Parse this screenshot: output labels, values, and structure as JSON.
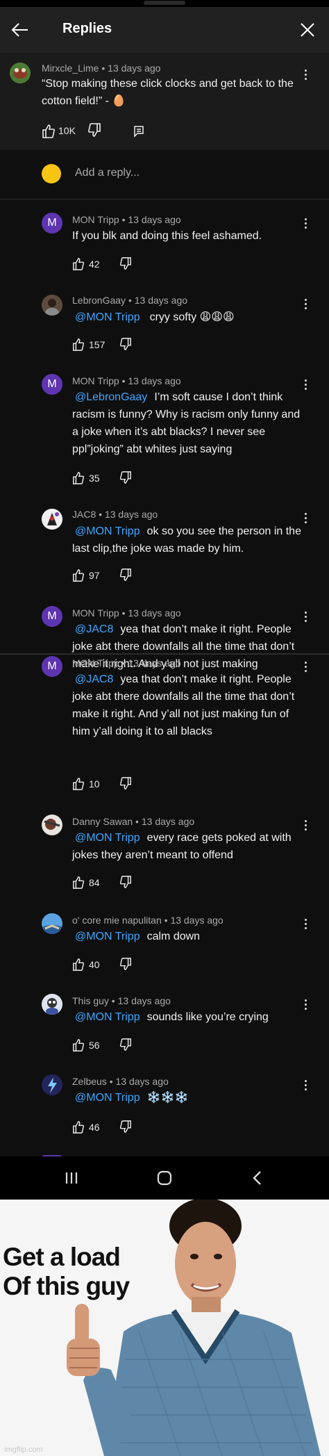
{
  "header": {
    "title": "Replies"
  },
  "parent": {
    "author": "Mirxcle_Lime",
    "age": "13 days ago",
    "text": "“Stop making these click clocks and get back to the cotton field!” - ",
    "likes": "10K"
  },
  "add_reply": {
    "placeholder": "Add a reply..."
  },
  "replies": [
    {
      "author": "MON Tripp",
      "age": "13 days ago",
      "mention": "",
      "text": "If you blk and doing this feel ashamed.",
      "likes": "42",
      "avatar_letter": "M"
    },
    {
      "author": "LebronGaay",
      "age": "13 days ago",
      "mention": "@MON Tripp",
      "text": "cryy softy 😩😩😩",
      "likes": "157",
      "avatar_letter": ""
    },
    {
      "author": "MON Tripp",
      "age": "13 days ago",
      "mention": "@LebronGaay",
      "text": "I’m soft cause I don’t think racism is funny? Why is racism only funny and a joke when it’s abt blacks? I never see ppl”joking” abt whites just saying",
      "likes": "35",
      "avatar_letter": "M"
    },
    {
      "author": "JAC8",
      "age": "13 days ago",
      "mention": "@MON Tripp",
      "text": "ok so you see the person in the last clip,the joke was made by him.",
      "likes": "97",
      "avatar_letter": ""
    },
    {
      "author": "MON Tripp",
      "age": "13 days ago",
      "mention": "@JAC8",
      "text": "yea that don’t make it right. People joke abt there downfalls all the time that don’t make it right. And y’all not just making",
      "likes": "",
      "avatar_letter": "M"
    },
    {
      "author": "MON Tripp",
      "age": "13 days ago",
      "mention": "@JAC8",
      "text": "yea that don’t make it right. People joke abt there downfalls all the time that don’t make it right. And y’all not just making fun of him y’all doing it to all blacks",
      "likes": "10",
      "avatar_letter": "M"
    },
    {
      "author": "Danny Sawan",
      "age": "13 days ago",
      "mention": "@MON Tripp",
      "text": "every race gets poked at with jokes they aren’t meant to offend",
      "likes": "84",
      "avatar_letter": ""
    },
    {
      "author": "o' core mie napulitan",
      "age": "13 days ago",
      "mention": "@MON Tripp",
      "text": "calm down",
      "likes": "40",
      "avatar_letter": ""
    },
    {
      "author": "This guy",
      "age": "13 days ago",
      "mention": "@MON Tripp",
      "text": "sounds like you’re crying",
      "likes": "56",
      "avatar_letter": ""
    },
    {
      "author": "Zelbeus",
      "age": "13 days ago",
      "mention": "@MON Tripp",
      "text": "❄️❄️❄️",
      "likes": "46",
      "avatar_letter": ""
    }
  ],
  "meme": {
    "line1": "Get a load",
    "line2": "Of this guy"
  },
  "watermark": "imgflip.com",
  "colors": {
    "mention": "#3ea6ff",
    "header_bg": "#212121",
    "avatar_purple": "#5e35b1",
    "yellow_avatar": "#f6c413"
  },
  "icons": [
    "back-arrow-icon",
    "close-icon",
    "thumbs-up-icon",
    "thumbs-down-icon",
    "reply-icon",
    "more-vert-icon",
    "recents-icon",
    "home-icon",
    "back-icon"
  ]
}
